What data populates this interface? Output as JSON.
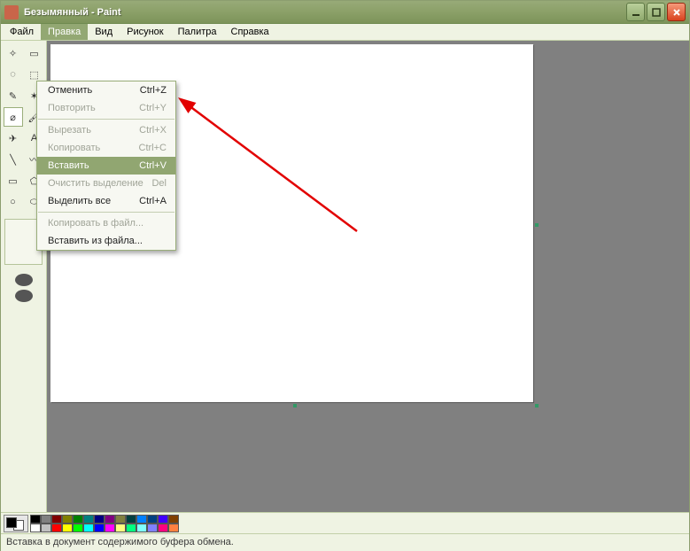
{
  "window": {
    "title": "Безымянный - Paint"
  },
  "menu": {
    "items": [
      "Файл",
      "Правка",
      "Вид",
      "Рисунок",
      "Палитра",
      "Справка"
    ],
    "open_index": 1
  },
  "dropdown": {
    "groups": [
      [
        {
          "label": "Отменить",
          "shortcut": "Ctrl+Z",
          "enabled": true
        },
        {
          "label": "Повторить",
          "shortcut": "Ctrl+Y",
          "enabled": false
        }
      ],
      [
        {
          "label": "Вырезать",
          "shortcut": "Ctrl+X",
          "enabled": false
        },
        {
          "label": "Копировать",
          "shortcut": "Ctrl+C",
          "enabled": false
        },
        {
          "label": "Вставить",
          "shortcut": "Ctrl+V",
          "enabled": true,
          "highlight": true
        },
        {
          "label": "Очистить выделение",
          "shortcut": "Del",
          "enabled": false
        },
        {
          "label": "Выделить все",
          "shortcut": "Ctrl+A",
          "enabled": true
        }
      ],
      [
        {
          "label": "Копировать в файл...",
          "shortcut": "",
          "enabled": false
        },
        {
          "label": "Вставить из файла...",
          "shortcut": "",
          "enabled": true
        }
      ]
    ]
  },
  "tools": [
    "✧",
    "▭",
    "◌",
    "⬚",
    "✎",
    "✶",
    "⌀",
    "🖌",
    "✈",
    "A",
    "╲",
    "〰",
    "▭",
    "⬠",
    "○",
    "⬭"
  ],
  "selected_tool_index": 6,
  "palette": {
    "row1": [
      "#000000",
      "#808080",
      "#800000",
      "#808000",
      "#008000",
      "#008080",
      "#000080",
      "#800080",
      "#808040",
      "#004040",
      "#0080ff",
      "#004080",
      "#4000ff",
      "#804000"
    ],
    "row2": [
      "#ffffff",
      "#c0c0c0",
      "#ff0000",
      "#ffff00",
      "#00ff00",
      "#00ffff",
      "#0000ff",
      "#ff00ff",
      "#ffff80",
      "#00ff80",
      "#80ffff",
      "#8080ff",
      "#ff0080",
      "#ff8040"
    ]
  },
  "status": "Вставка в документ содержимого буфера обмена."
}
